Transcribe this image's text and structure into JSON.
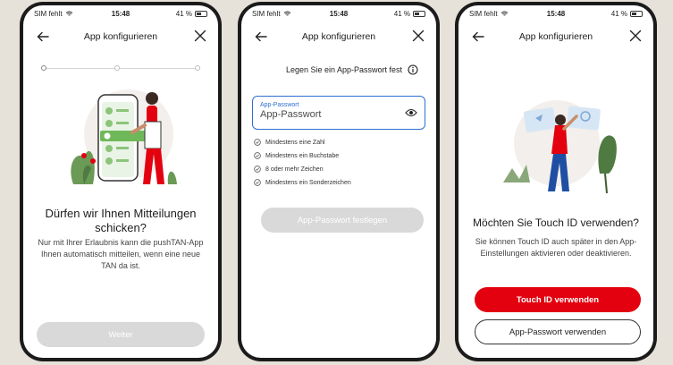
{
  "screens": [
    {
      "status": {
        "carrier": "SIM fehlt",
        "time": "15:48",
        "battery": "41 %"
      },
      "header": {
        "title": "App konfigurieren"
      },
      "heading": "Dürfen wir Ihnen Mitteilungen schicken?",
      "body": "Nur mit Ihrer Erlaubnis kann die pushTAN-App Ihnen automatisch mitteilen, wenn eine neue TAN da ist.",
      "button": "Weiter"
    },
    {
      "status": {
        "carrier": "SIM fehlt",
        "time": "15:48",
        "battery": "41 %"
      },
      "header": {
        "title": "App konfigurieren"
      },
      "prompt": "Legen Sie ein App-Passwort fest",
      "field": {
        "label": "App-Passwort",
        "placeholder": "App-Passwort"
      },
      "requirements": [
        "Mindestens eine Zahl",
        "Mindestens ein Buchstabe",
        "8 oder mehr Zeichen",
        "Mindestens ein Sonderzeichen"
      ],
      "button": "App-Passwort festlegen"
    },
    {
      "status": {
        "carrier": "SIM fehlt",
        "time": "15:48",
        "battery": "41 %"
      },
      "header": {
        "title": "App konfigurieren"
      },
      "heading": "Möchten Sie Touch ID verwenden?",
      "body": "Sie können Touch ID auch später in den App-Einstellungen aktivieren oder deaktivieren.",
      "primary_button": "Touch ID verwenden",
      "secondary_button": "App-Passwort verwenden"
    }
  ],
  "colors": {
    "accent_red": "#e3000f",
    "field_blue": "#2e6fd1",
    "disabled": "#d9d9d9"
  },
  "icons": [
    "wifi-icon",
    "battery-icon",
    "back-arrow-icon",
    "close-icon",
    "info-icon",
    "eye-icon",
    "check-circle-icon"
  ]
}
